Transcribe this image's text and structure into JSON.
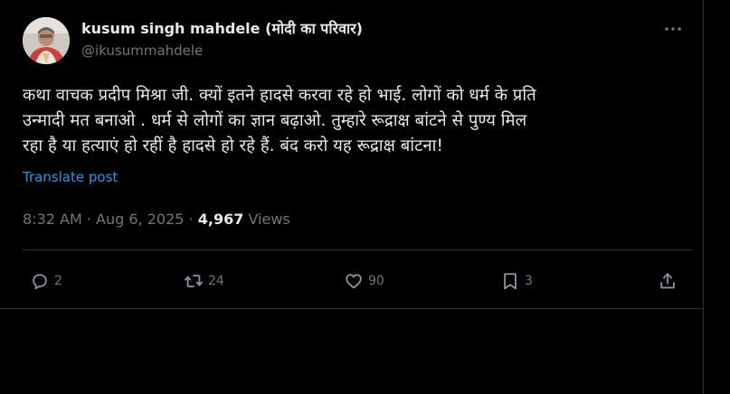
{
  "author": {
    "display_name": "kusum singh mahdele (मोदी का परिवार)",
    "handle": "@ikusummahdele"
  },
  "post": {
    "lines": [
      "कथा वाचक प्रदीप मिश्रा जी. क्यों इतने हादसे करवा रहे हो भाई. लोगों को धर्म के प्रति",
      "उन्मादी मत बनाओ . धर्म से लोगों का ज्ञान बढ़ाओ. तुम्हारे रूद्राक्ष बांटने से पुण्य मिल",
      "रहा है या हत्याएं हो रहीं है हादसे हो रहे हैं. बंद करो यह रूद्राक्ष बांटना!"
    ],
    "translate_label": "Translate post",
    "time": "8:32 AM",
    "date": "Aug 6, 2025",
    "separator": "·",
    "views_count": "4,967",
    "views_label": "Views"
  },
  "actions": {
    "reply_count": "2",
    "repost_count": "24",
    "like_count": "90",
    "bookmark_count": "3"
  },
  "icons": {
    "more": "more-horizontal-icon",
    "reply": "reply-bubble-icon",
    "repost": "repost-arrows-icon",
    "like": "heart-icon",
    "bookmark": "bookmark-icon",
    "share": "share-upload-icon"
  },
  "colors": {
    "background": "#000000",
    "text": "#e7e9ea",
    "muted": "#71767b",
    "link": "#1d9bf0",
    "border": "#2f3336"
  }
}
